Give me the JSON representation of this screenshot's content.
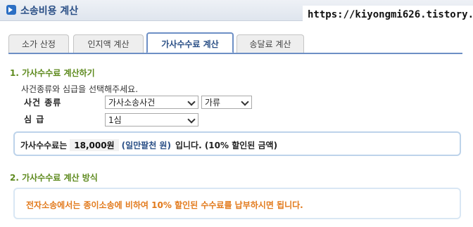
{
  "window": {
    "title": "소송비용 계산"
  },
  "watermark": "https://kiyongmi626.tistory.com",
  "tabs": [
    {
      "label": "소가 산정"
    },
    {
      "label": "인지액 계산"
    },
    {
      "label": "가사수수료 계산"
    },
    {
      "label": "송달료 계산"
    }
  ],
  "section1": {
    "title": "1. 가사수수료 계산하기",
    "hint": "사건종류와 심급을 선택해주세요.",
    "case_type_label": "사건 종류",
    "case_type_value": "가사소송사건",
    "case_class_value": "가류",
    "instance_label": "심 급",
    "instance_value": "1심"
  },
  "result": {
    "prefix": "가사수수료는",
    "amount": "18,000원",
    "amount_words": "(일만팔천 원)",
    "suffix": "입니다. (10% 할인된 금액)"
  },
  "section2": {
    "title": "2. 가사수수료 계산 방식",
    "description": "전자소송에서는 종이소송에 비하여 10% 할인된 수수료를 납부하시면 됩니다."
  },
  "colors": {
    "accent": "#2a4f86",
    "section_title": "#5e8a1e",
    "notice": "#e27a1c"
  }
}
